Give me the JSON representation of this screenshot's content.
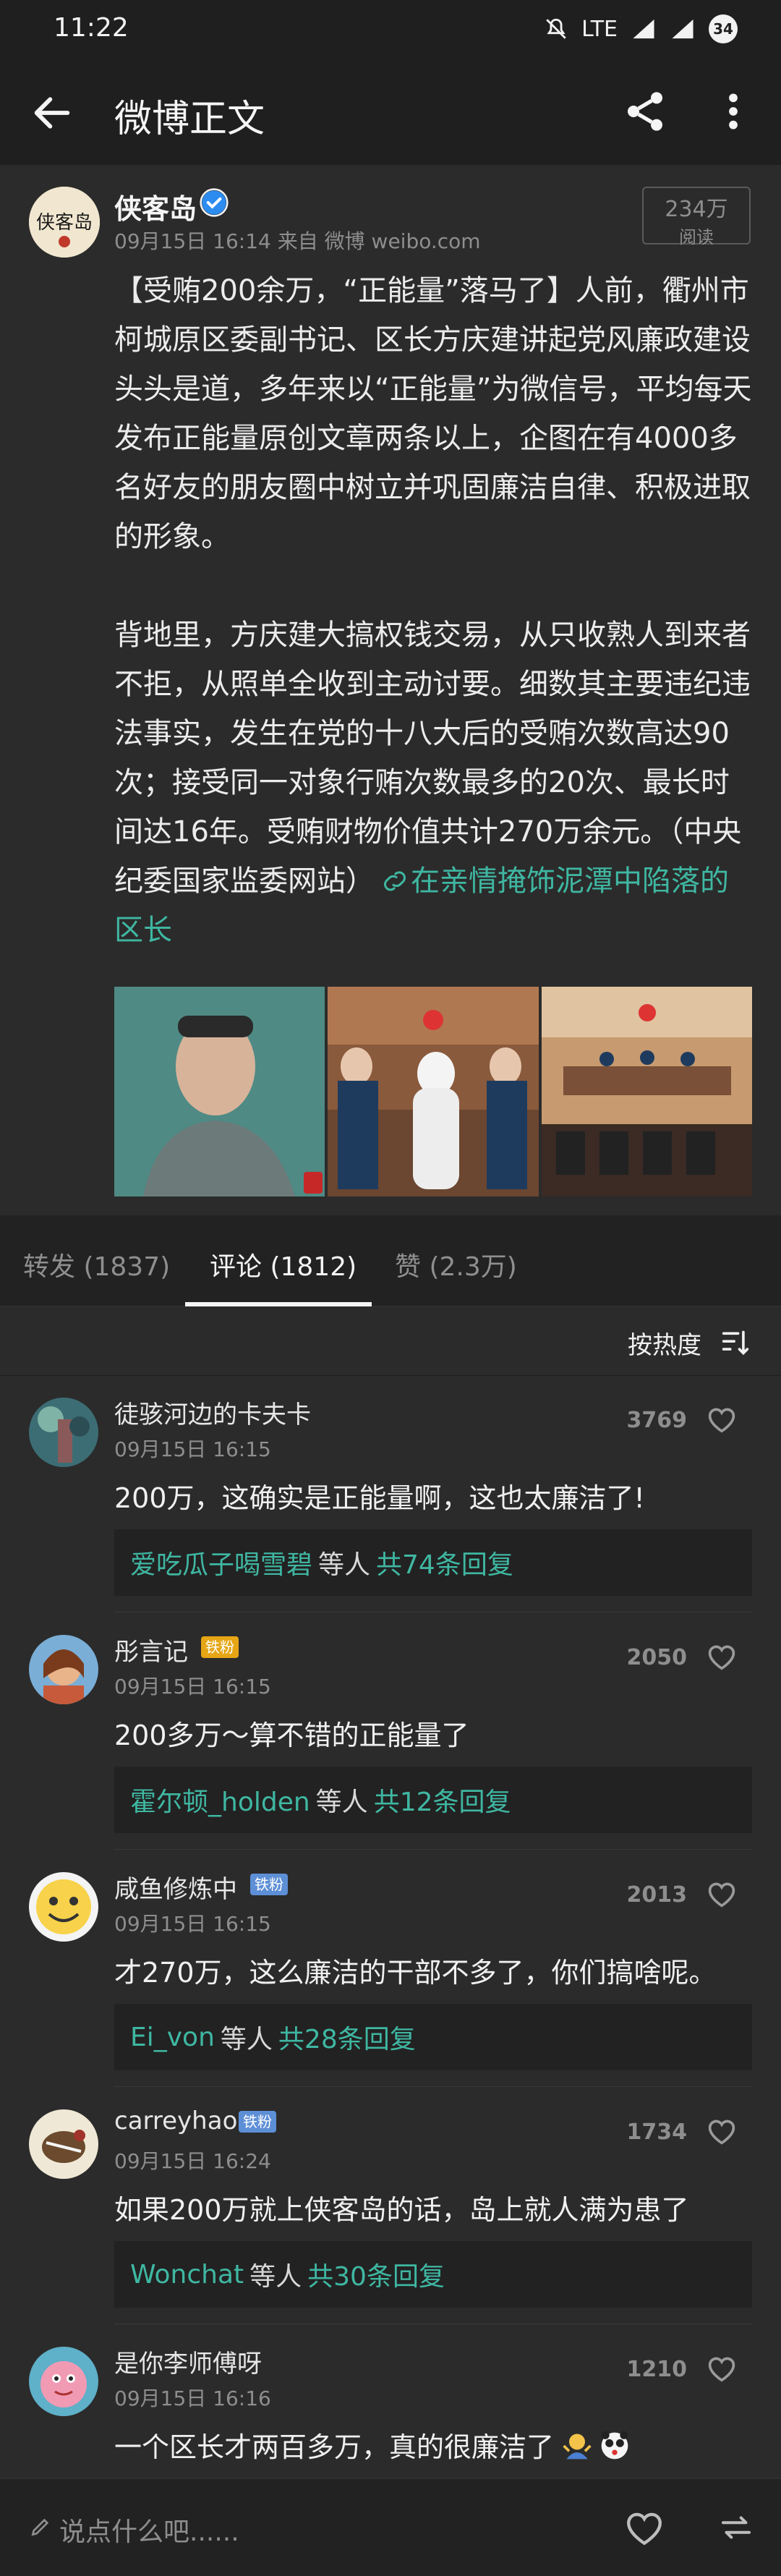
{
  "status_bar": {
    "time": "11:22",
    "network": "LTE",
    "battery": "34"
  },
  "header": {
    "title": "微博正文"
  },
  "post": {
    "author": "侠客岛",
    "avatar_text": "侠客岛",
    "meta": "09月15日 16:14  来自 微博 weibo.com",
    "read_count": "234万",
    "read_label": "阅读",
    "body": "【受贿200余万，“正能量”落马了】人前，衢州市柯城原区委副书记、区长方庆建讲起党风廉政建设头头是道，多年来以“正能量”为微信号，平均每天发布正能量原创文章两条以上，企图在有4000多名好友的朋友圈中树立并巩固廉洁自律、积极进取的形象。\n\n背地里，方庆建大搞权钱交易，从只收熟人到来者不拒，从照单全收到主动讨要。细数其主要违纪违法事实，发生在党的十八大后的受贿次数高达90次；接受同一对象行贿次数最多的20次、最长时间达16年。受贿财物价值共计270万余元。（中央纪委国家监委网站）",
    "link_text": "在亲情掩饰泥潭中陷落的区长"
  },
  "tabs": [
    {
      "label": "转发 (1837)"
    },
    {
      "label": "评论 (1812)"
    },
    {
      "label": "赞 (2.3万)"
    }
  ],
  "sort": {
    "label": "按热度"
  },
  "comments": [
    {
      "name": "徒骇河边的卡夫卡",
      "time": "09月15日 16:15",
      "likes": "3769",
      "text": "200万，这确实是正能量啊，这也太廉洁了!",
      "reply_user": "爱吃瓜子喝雪碧",
      "reply_etc": "等人",
      "reply_count": "共74条回复",
      "badge": ""
    },
    {
      "name": "彤言记",
      "time": "09月15日 16:15",
      "likes": "2050",
      "text": "200多万～算不错的正能量了",
      "reply_user": "霍尔顿_holden",
      "reply_etc": "等人",
      "reply_count": "共12条回复",
      "badge": "铁粉"
    },
    {
      "name": "咸鱼修炼中",
      "time": "09月15日 16:15",
      "likes": "2013",
      "text": "才270万，这么廉洁的干部不多了，你们搞啥呢。",
      "reply_user": "Ei_von",
      "reply_etc": "等人",
      "reply_count": "共28条回复",
      "badge": "铁粉"
    },
    {
      "name": "carreyhao",
      "time": "09月15日 16:24",
      "likes": "1734",
      "text": "如果200万就上侠客岛的话，岛上就人满为患了",
      "reply_user": "Wonchat",
      "reply_etc": "等人",
      "reply_count": "共30条回复",
      "badge": "铁粉"
    },
    {
      "name": "是你李师傅呀",
      "time": "09月15日 16:16",
      "likes": "1210",
      "text": "一个区长才两百多万，真的很廉洁了",
      "reply_user": "",
      "reply_etc": "",
      "reply_count": "",
      "badge": ""
    }
  ],
  "bottom_bar": {
    "placeholder": "说点什么吧......"
  },
  "colors": {
    "accent": "#3fb7a2",
    "background": "#2b2b2b",
    "bar": "#1f1f1f"
  }
}
